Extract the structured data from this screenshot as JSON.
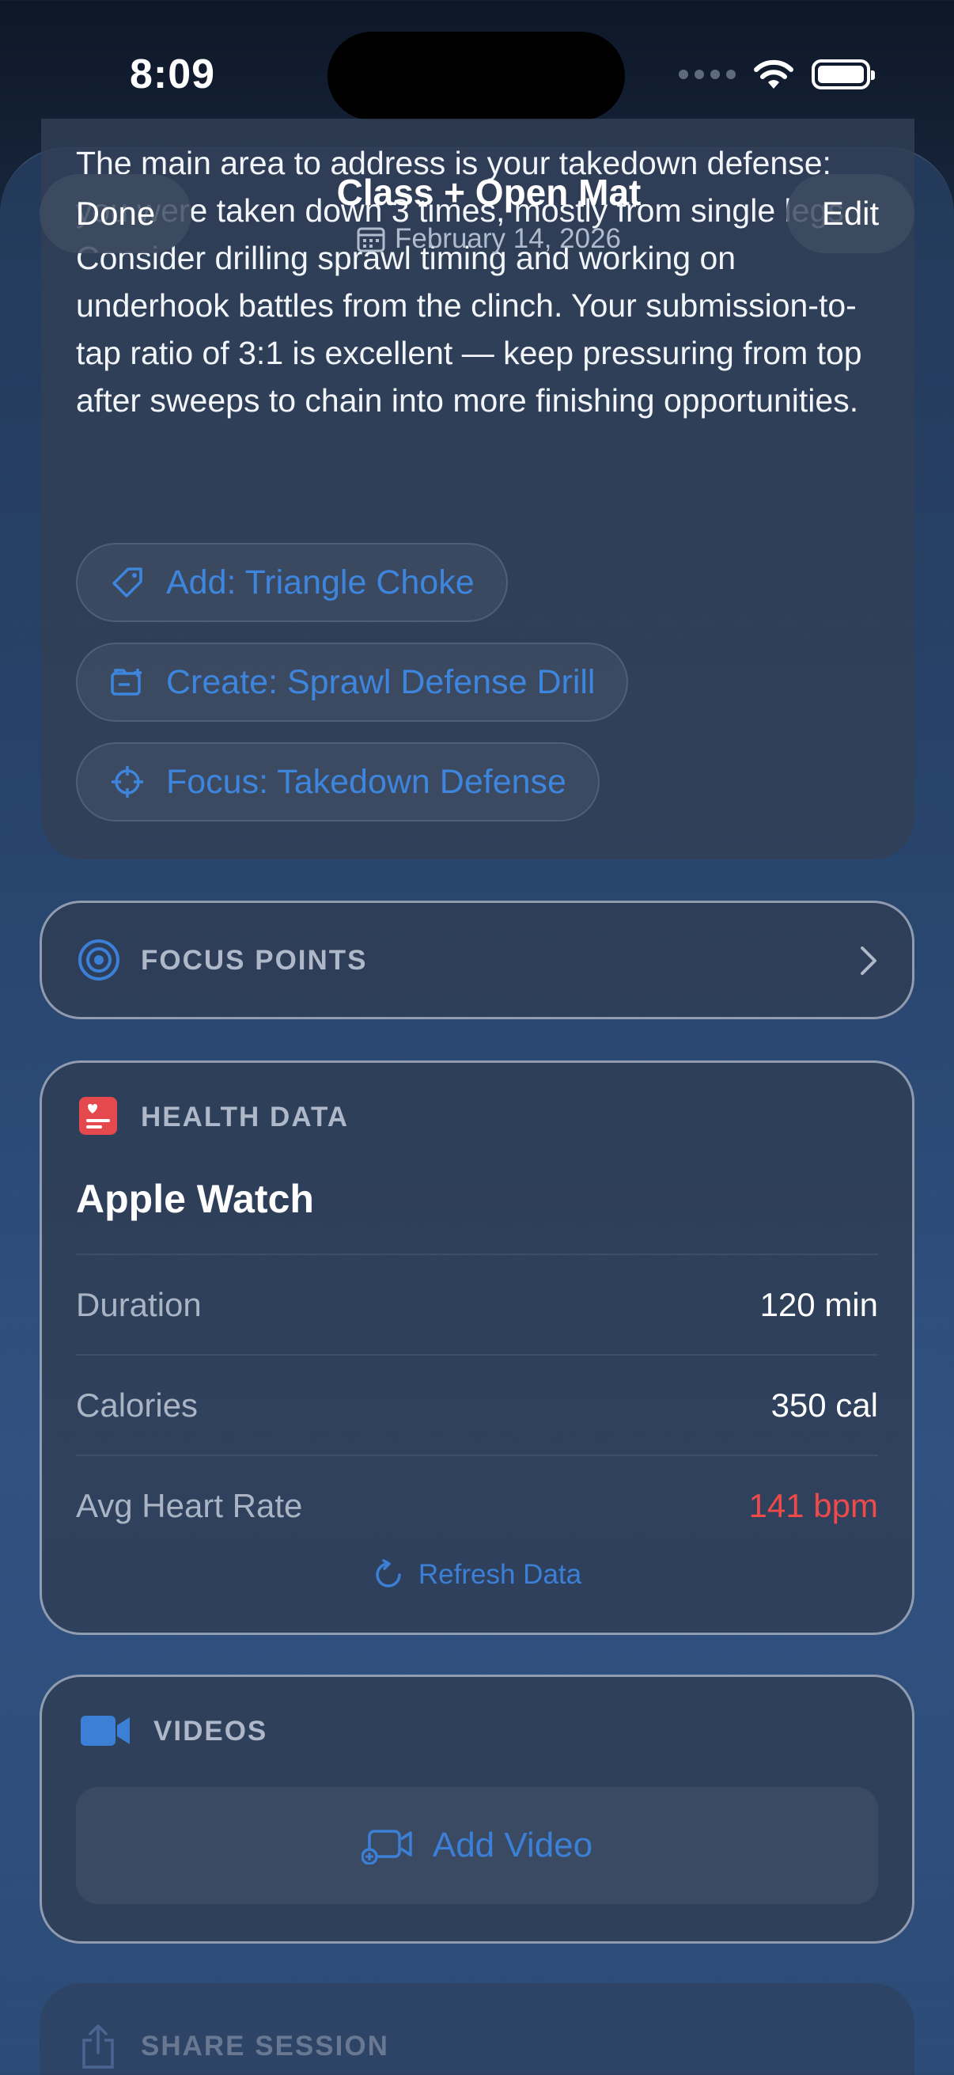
{
  "status_bar": {
    "time": "8:09"
  },
  "nav": {
    "done_label": "Done",
    "title": "Class + Open Mat",
    "date": "February 14, 2026",
    "edit_label": "Edit"
  },
  "insight": {
    "text": "The main area to address is your takedown defense: you were taken down 3 times, mostly from single legs. Consider drilling sprawl timing and working on underhook battles from the clinch. Your submission-to-tap ratio of 3:1 is excellent — keep pressuring from top after sweeps to chain into more finishing opportunities.",
    "actions": [
      {
        "label": "Add: Triangle Choke",
        "icon": "tag-icon"
      },
      {
        "label": "Create: Sprawl Defense Drill",
        "icon": "drill-folder-icon"
      },
      {
        "label": "Focus: Takedown Defense",
        "icon": "crosshair-icon"
      }
    ]
  },
  "focus_points": {
    "label": "FOCUS POINTS"
  },
  "health": {
    "label": "HEALTH DATA",
    "source": "Apple Watch",
    "rows": [
      {
        "label": "Duration",
        "value": "120 min"
      },
      {
        "label": "Calories",
        "value": "350 cal"
      },
      {
        "label": "Avg Heart Rate",
        "value": "141 bpm"
      }
    ],
    "refresh_label": "Refresh Data",
    "heart_rate_color": "#ef4a4a"
  },
  "videos": {
    "label": "VIDEOS",
    "add_label": "Add Video"
  },
  "share": {
    "label": "SHARE SESSION"
  },
  "colors": {
    "accent": "#3b80d6",
    "health_icon": "#e5484d"
  }
}
